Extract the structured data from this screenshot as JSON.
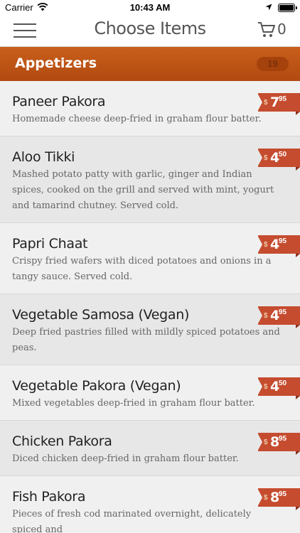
{
  "status_bar": {
    "carrier": "Carrier",
    "time": "10:43 AM",
    "wifi_icon": "wifi-icon",
    "location_icon": "location-arrow-icon",
    "battery_icon": "battery-full-icon"
  },
  "nav": {
    "title": "Choose Items",
    "cart_count": "0",
    "menu_icon": "hamburger-menu-icon",
    "cart_icon": "shopping-cart-icon"
  },
  "category": {
    "title": "Appetizers",
    "count": "19",
    "color": "#b8501a"
  },
  "price_tag_color": "#c54c2f",
  "items": [
    {
      "name": "Paneer Pakora",
      "description": "Homemade cheese deep-fried in graham flour batter.",
      "currency": "$",
      "price_whole": "7",
      "price_cents": "95"
    },
    {
      "name": "Aloo Tikki",
      "description": "Mashed potato patty with garlic, ginger and Indian spices, cooked on the grill and served with mint, yogurt and tamarind chutney. Served cold.",
      "currency": "$",
      "price_whole": "4",
      "price_cents": "50"
    },
    {
      "name": "Papri Chaat",
      "description": "Crispy fried wafers with diced potatoes and onions in a tangy sauce. Served cold.",
      "currency": "$",
      "price_whole": "4",
      "price_cents": "95"
    },
    {
      "name": "Vegetable Samosa (Vegan)",
      "description": "Deep fried pastries filled with mildly spiced potatoes and peas.",
      "currency": "$",
      "price_whole": "4",
      "price_cents": "95"
    },
    {
      "name": "Vegetable Pakora (Vegan)",
      "description": "Mixed vegetables deep-fried in graham flour batter.",
      "currency": "$",
      "price_whole": "4",
      "price_cents": "50"
    },
    {
      "name": "Chicken Pakora",
      "description": "Diced chicken deep-fried in graham flour batter.",
      "currency": "$",
      "price_whole": "8",
      "price_cents": "95"
    },
    {
      "name": "Fish Pakora",
      "description": "Pieces of fresh cod marinated overnight, delicately spiced and",
      "currency": "$",
      "price_whole": "8",
      "price_cents": "95"
    }
  ]
}
